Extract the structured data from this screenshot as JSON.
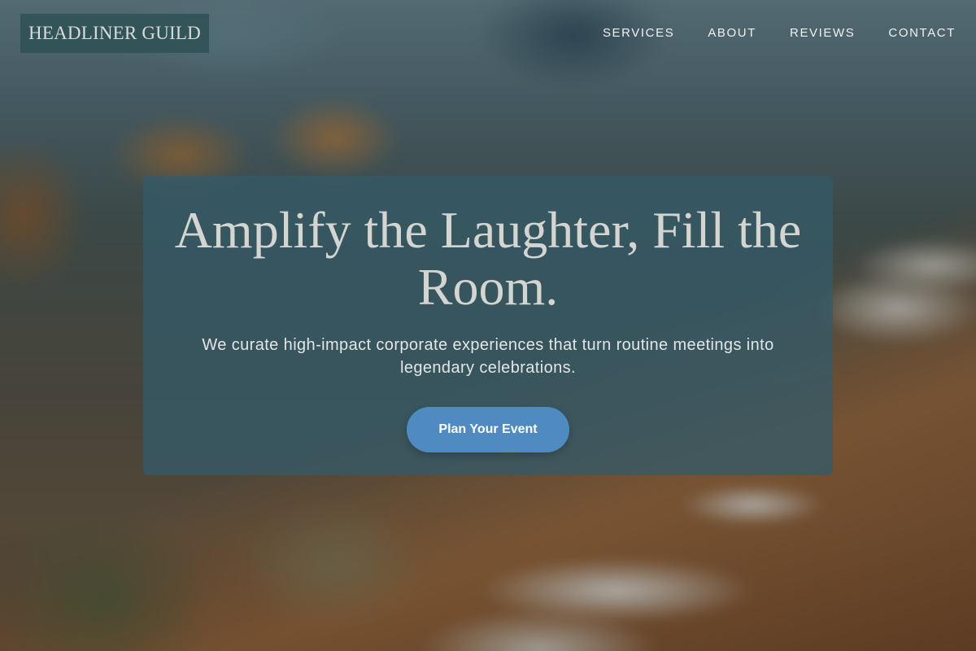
{
  "brand": {
    "logo_text": "HEADLINER GUILD"
  },
  "nav": {
    "items": [
      {
        "label": "SERVICES"
      },
      {
        "label": "ABOUT"
      },
      {
        "label": "REVIEWS"
      },
      {
        "label": "CONTACT"
      }
    ]
  },
  "hero": {
    "headline": "Amplify the Laughter, Fill the Room.",
    "subtext": "We curate high-impact corporate experiences that turn routine meetings into legendary celebrations.",
    "cta_label": "Plan Your Event"
  },
  "colors": {
    "logo_background": "#2f5255",
    "card_background": "#355a68",
    "cta_background": "#4f8ac1",
    "headline_text": "#d4d5d1"
  }
}
